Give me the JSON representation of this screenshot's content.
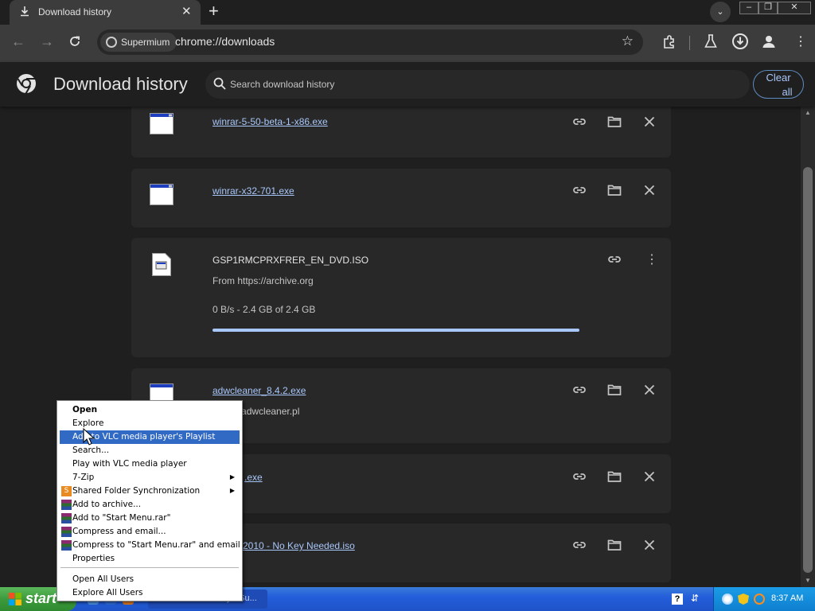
{
  "browser": {
    "tab": {
      "title": "Download history",
      "close_glyph": "✕"
    },
    "new_tab_glyph": "+",
    "profile_chip": "Supermium",
    "url": "chrome://downloads",
    "window_buttons": [
      "–",
      "❐",
      "✕"
    ]
  },
  "page": {
    "title": "Download history",
    "search_placeholder": "Search download history",
    "clear_all_line1": "Clear",
    "clear_all_line2": "all"
  },
  "downloads": [
    {
      "name": "winrar-5-50-beta-1-x86.exe",
      "link": true
    },
    {
      "name": "winrar-x32-701.exe",
      "link": true
    },
    {
      "name": "GSP1RMCPRXFRER_EN_DVD.ISO",
      "link": false,
      "from": "From https://archive.org",
      "status": "0 B/s - 2.4 GB of 2.4 GB",
      "progress": 1.0
    },
    {
      "name": "adwcleaner_8.4.2.exe",
      "link": true,
      "from": "https://adwcleaner.pl"
    },
    {
      "name": ".exe",
      "link": true
    },
    {
      "name": "2010 - No Key Needed.iso",
      "link": true
    }
  ],
  "context_menu": {
    "items": [
      {
        "label": "Open",
        "bold": true
      },
      {
        "label": "Explore"
      },
      {
        "label": "Add to VLC media player's Playlist",
        "selected": true
      },
      {
        "label": "Search..."
      },
      {
        "label": "Play with VLC media player"
      },
      {
        "label": "7-Zip",
        "submenu": true
      },
      {
        "label": "Shared Folder Synchronization",
        "submenu": true,
        "icon": "sync-icon"
      },
      {
        "label": "Add to archive...",
        "icon": "winrar-icon"
      },
      {
        "label": "Add to \"Start Menu.rar\"",
        "icon": "winrar-icon"
      },
      {
        "label": "Compress and email...",
        "icon": "winrar-icon"
      },
      {
        "label": "Compress to \"Start Menu.rar\" and email",
        "icon": "winrar-icon"
      },
      {
        "label": "Properties"
      },
      {
        "label": "Open All Users"
      },
      {
        "label": "Explore All Users"
      }
    ]
  },
  "taskbar": {
    "start_label": "start",
    "task_label": "Download history - Su...",
    "clock": "8:37 AM",
    "help_glyph": "?"
  },
  "colors": {
    "link": "#a8c7fa",
    "card_bg": "#282828",
    "page_bg": "#1f1f1f",
    "menu_highlight": "#316ac5"
  }
}
